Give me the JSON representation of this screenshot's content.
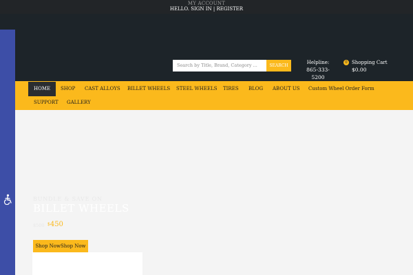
{
  "topbar": {
    "account_label": "MY ACCOUNT",
    "greeting": "HELLO.",
    "sign_in": "SIGN IN",
    "separator": "|",
    "register": "REGISTER"
  },
  "search": {
    "placeholder": "Search by Title, Brand, Category ...",
    "button_label": "SEARCH"
  },
  "helpline": {
    "label": "Helpline:",
    "number": "865-333-5200"
  },
  "cart": {
    "count": "0",
    "label": "Shopping Cart",
    "total": "$0.00"
  },
  "nav": {
    "items": [
      {
        "label": "HOME",
        "active": true
      },
      {
        "label": "SHOP"
      },
      {
        "label": "CAST ALLOYS"
      },
      {
        "label": "BILLET WHEELS"
      },
      {
        "label": "STEEL WHEELS"
      },
      {
        "label": "TIRES"
      },
      {
        "label": "BLOG"
      },
      {
        "label": "ABOUT US"
      },
      {
        "label": "Custom Wheel Order Form"
      },
      {
        "label": "SUPPORT"
      },
      {
        "label": "GALLERY"
      }
    ]
  },
  "accessibility": {
    "icon": "accessibility-icon"
  },
  "hero": {
    "subtitle": "BUNDLE & SAVE ON",
    "title": "BILLET WHEELS",
    "old_price": "$500",
    "price_symbol": "$",
    "price_value": "450",
    "button_label": "Shop NowShop Now"
  },
  "colors": {
    "accent": "#fbb91c",
    "header_bg": "#1d2429",
    "topbar_bg": "#222528",
    "sidebar_bg": "#3d4ea7"
  }
}
